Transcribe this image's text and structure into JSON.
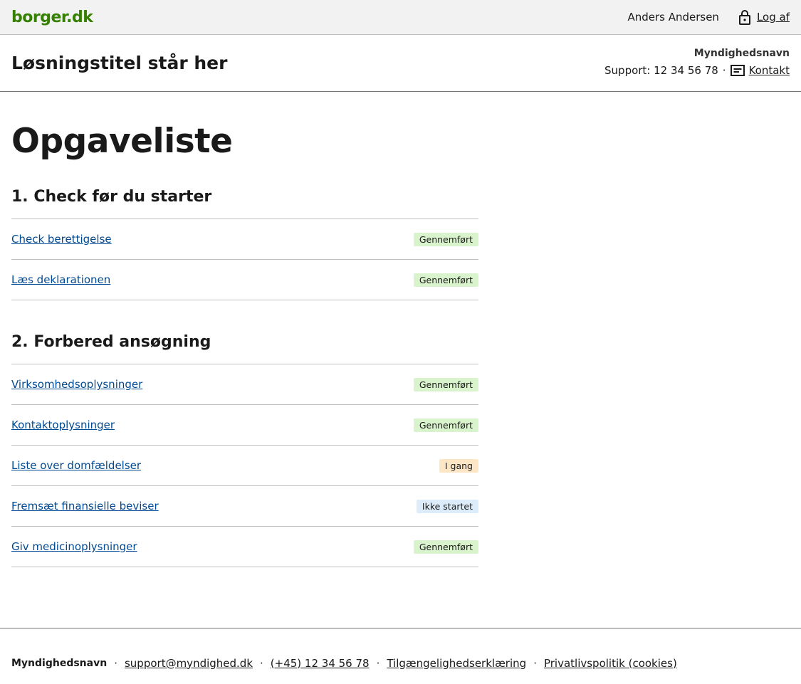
{
  "portal": {
    "logo": "borger.dk",
    "user_name": "Anders Andersen",
    "logout_label": "Log af"
  },
  "solution": {
    "title": "Løsningstitel står her",
    "authority": "Myndighedsnavn",
    "support_text": "Support: 12 34 56 78",
    "separator": "·",
    "contact_label": "Kontakt"
  },
  "main": {
    "page_title": "Opgaveliste",
    "sections": [
      {
        "title": "1. Check før du starter",
        "tasks": [
          {
            "label": "Check berettigelse",
            "status": "Gennemført"
          },
          {
            "label": "Læs deklarationen",
            "status": "Gennemført"
          }
        ]
      },
      {
        "title": "2. Forbered ansøgning",
        "tasks": [
          {
            "label": "Virksomhedsoplysninger",
            "status": "Gennemført"
          },
          {
            "label": "Kontaktoplysninger",
            "status": "Gennemført"
          },
          {
            "label": "Liste over domfældelser",
            "status": "I gang"
          },
          {
            "label": "Fremsæt finansielle beviser",
            "status": "Ikke startet"
          },
          {
            "label": "Giv medicinoplysninger",
            "status": "Gennemført"
          }
        ]
      }
    ]
  },
  "footer": {
    "authority": "Myndighedsnavn",
    "email": "support@myndighed.dk",
    "phone": "(+45) 12 34 56 78",
    "accessibility": "Tilgængelighedserklæring",
    "privacy": "Privatlivspolitik (cookies)",
    "separator": "·"
  },
  "colors": {
    "logo_green": "#358000",
    "link_blue": "#004993",
    "status_done": "#d9f3cc",
    "status_in_progress": "#fde6c6",
    "status_not_started": "#dcecfa"
  },
  "icons": {
    "logout": "lock-icon",
    "contact": "message-icon"
  }
}
